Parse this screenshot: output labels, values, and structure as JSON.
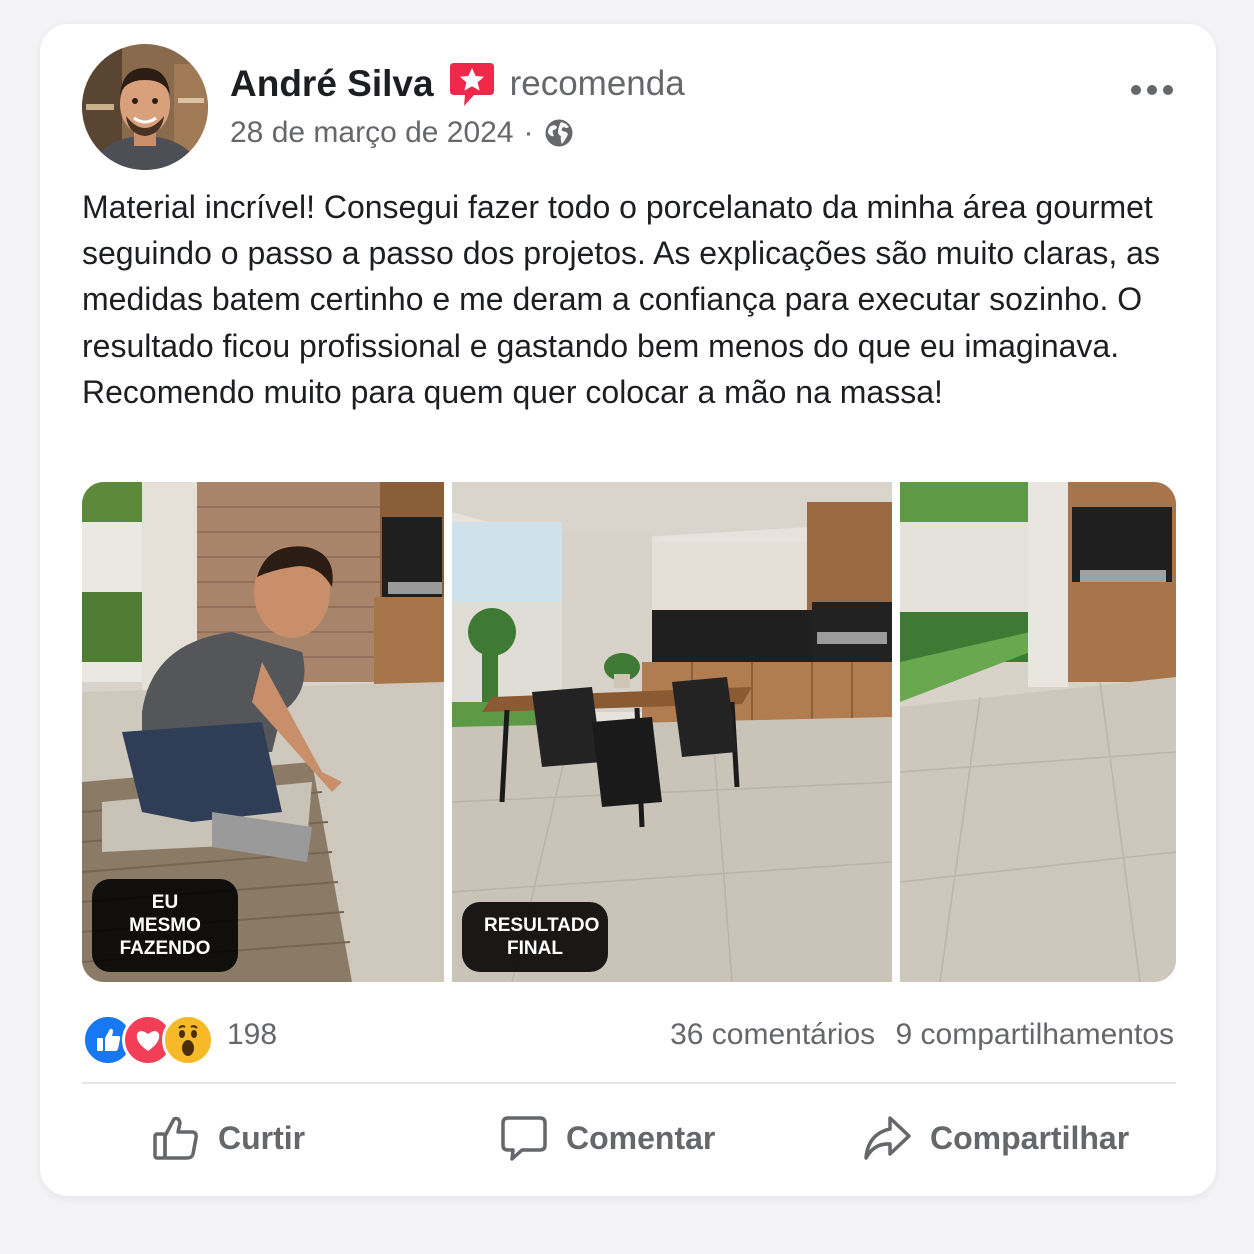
{
  "post": {
    "author": "André Silva",
    "recommendation_text": "recomenda",
    "date": "28 de março de 2024",
    "date_separator": "·",
    "privacy_icon": "globe-icon",
    "more_icon": "more-options-icon",
    "body": "Material incrível! Consegui fazer todo o porcelanato da minha área gourmet seguindo o passo a passo dos projetos. As explicações são muito claras, as medidas batem certinho e me deram a confiança para executar sozinho. O resultado ficou profissional e gastando bem menos do que eu imaginava. Recomendo muito para quem quer colocar a mão na massa!"
  },
  "gallery": {
    "photos": [
      {
        "label": "EU MESMO FAZENDO",
        "subject": "homem assentando porcelanato"
      },
      {
        "label": "RESULTADO FINAL",
        "subject": "área gourmet finalizada"
      },
      {
        "label": "",
        "subject": "piso de porcelanato e jardim"
      }
    ]
  },
  "reactions": {
    "icons": [
      "like-icon",
      "love-icon",
      "wow-icon"
    ],
    "count": "198",
    "comments": "36 comentários",
    "shares": "9 compartilhamentos"
  },
  "actions": {
    "like": "Curtir",
    "comment": "Comentar",
    "share": "Compartilhar"
  },
  "colors": {
    "like_blue": "#1877f2",
    "love_red": "#f33e58",
    "wow_yellow": "#f7b928",
    "recommend_red": "#f02849",
    "muted_text": "#65676b"
  }
}
